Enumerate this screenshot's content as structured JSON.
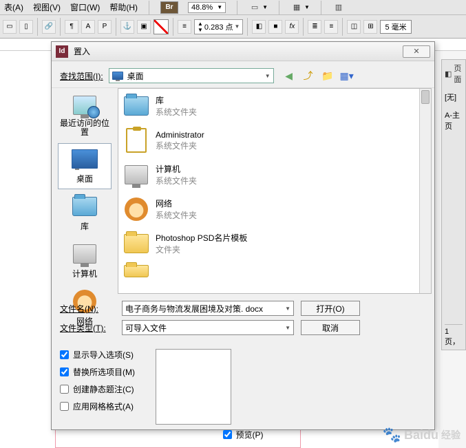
{
  "menubar": {
    "items": [
      "表(A)",
      "视图(V)",
      "窗口(W)",
      "帮助(H)"
    ],
    "br": "Br",
    "zoom": "48.8%"
  },
  "toolbar": {
    "stroke_value": "0.283 点",
    "size_value": "5 毫米"
  },
  "right_panel": {
    "pages": "页面",
    "none": "[无]",
    "master": "A-主页",
    "pager": "1 页，"
  },
  "dialog": {
    "title": "置入",
    "lookin_label": "查找范围(I):",
    "lookin_value": "桌面",
    "places": [
      {
        "label": "最近访问的位置",
        "icon": "recent"
      },
      {
        "label": "桌面",
        "icon": "desktop",
        "selected": true
      },
      {
        "label": "库",
        "icon": "library"
      },
      {
        "label": "计算机",
        "icon": "computer"
      },
      {
        "label": "网络",
        "icon": "network"
      }
    ],
    "files": [
      {
        "name": "库",
        "sub": "系统文件夹",
        "icon": "library-folder"
      },
      {
        "name": "Administrator",
        "sub": "系统文件夹",
        "icon": "clipboard"
      },
      {
        "name": "计算机",
        "sub": "系统文件夹",
        "icon": "computer"
      },
      {
        "name": "网络",
        "sub": "系统文件夹",
        "icon": "network"
      },
      {
        "name": "Photoshop PSD名片模板",
        "sub": "文件夹",
        "icon": "folder"
      }
    ],
    "filename_label": "文件名(N):",
    "filename_value": "电子商务与物流发展困境及对策. docx",
    "filetype_label": "文件类型(T):",
    "filetype_value": "可导入文件",
    "open_btn": "打开(O)",
    "cancel_btn": "取消",
    "checks": {
      "show_import": "显示导入选项(S)",
      "replace_sel": "替换所选项目(M)",
      "static_caption": "创建静态题注(C)",
      "grid_format": "应用网格格式(A)"
    },
    "preview_label": "预览(P)"
  },
  "watermark": {
    "brand": "Baidu",
    "sub": "经验"
  }
}
